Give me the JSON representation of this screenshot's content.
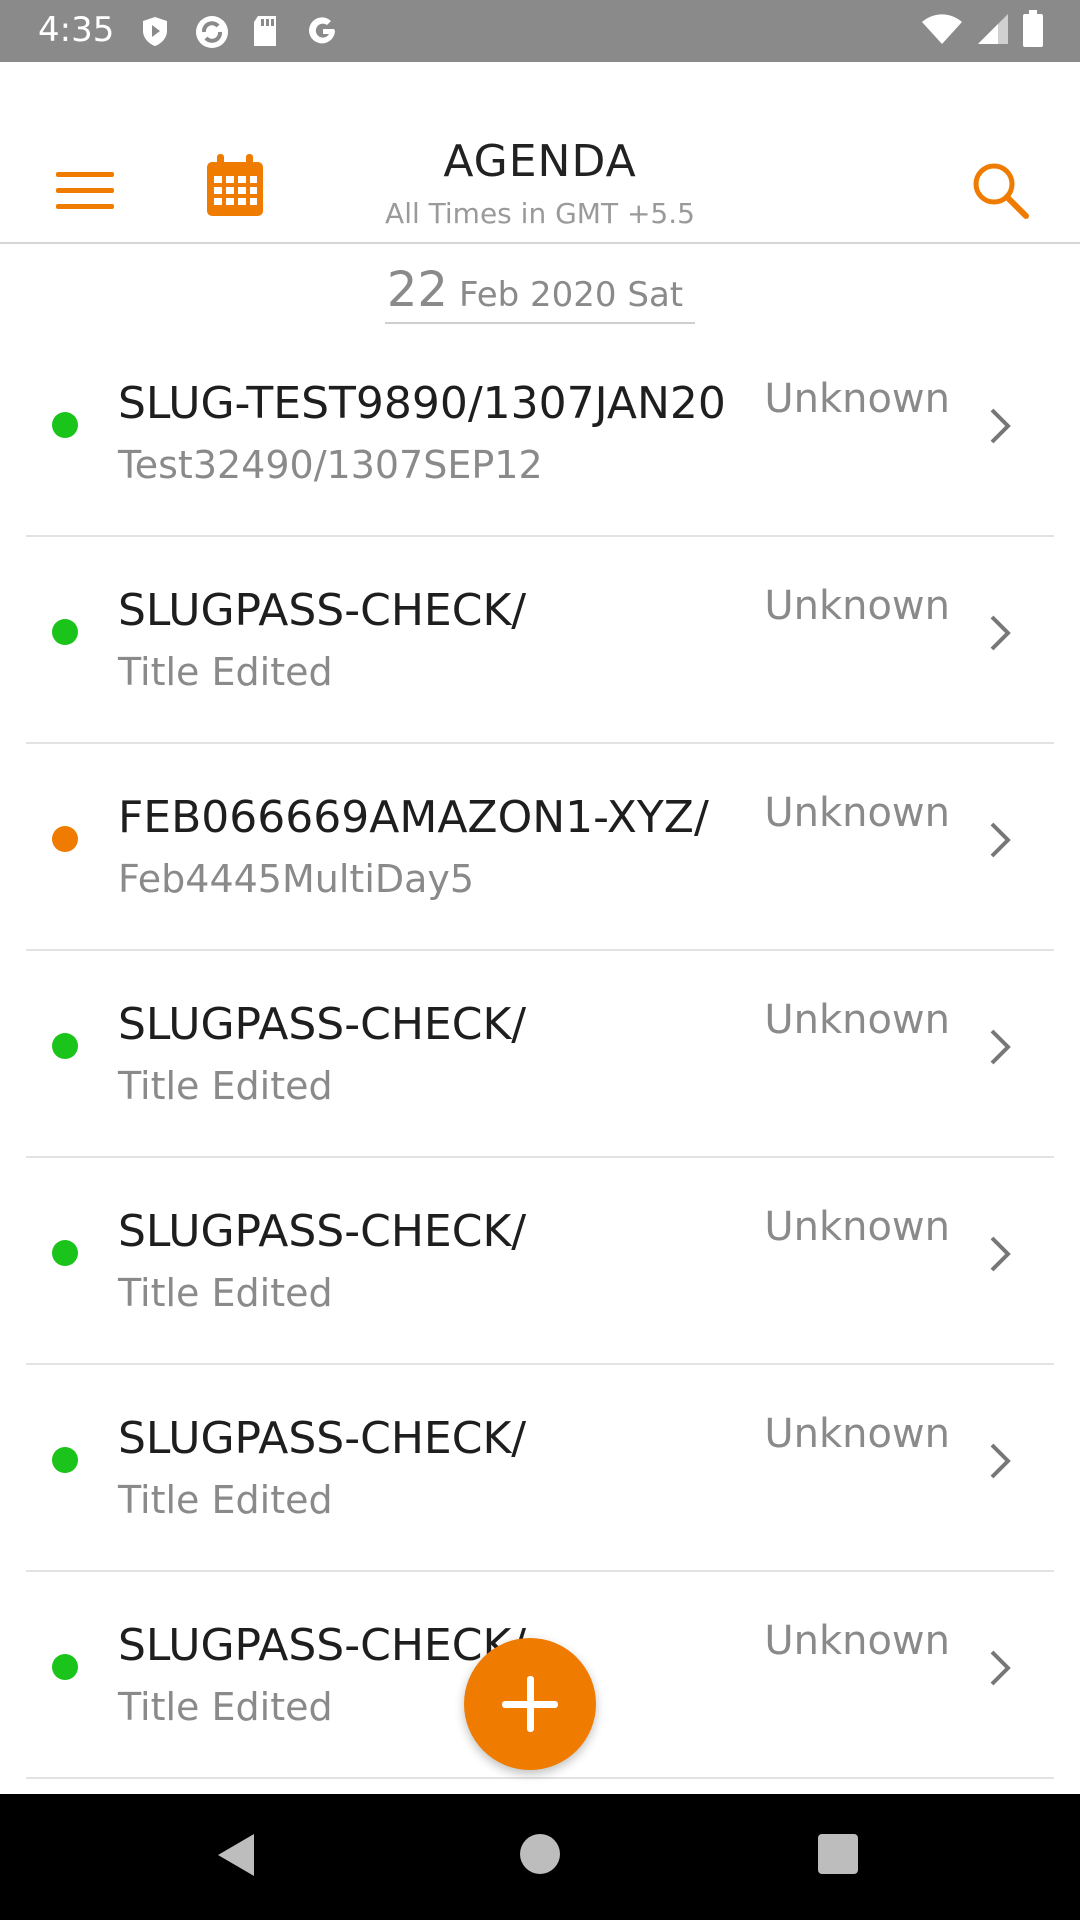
{
  "status_bar": {
    "time": "4:35",
    "icons_left": [
      "shield-play-icon",
      "sync-icon",
      "sd-card-icon",
      "google-icon"
    ],
    "icons_right": [
      "wifi-icon",
      "signal-icon",
      "battery-icon"
    ]
  },
  "app_bar": {
    "title": "AGENDA",
    "subtitle": "All Times in GMT +5.5",
    "accent_color": "#ef7c00"
  },
  "date_header": {
    "day": "22",
    "rest": "Feb 2020 Sat"
  },
  "items": [
    {
      "slug": "SLUG-TEST9890/1307JAN20",
      "title": "Test32490/1307SEP12",
      "status": "Unknown",
      "dot_color": "#1bc41b"
    },
    {
      "slug": "SLUGPASS-CHECK/",
      "title": "Title Edited",
      "status": "Unknown",
      "dot_color": "#1bc41b"
    },
    {
      "slug": "FEB066669AMAZON1-XYZ/",
      "title": "Feb4445MultiDay5",
      "status": "Unknown",
      "dot_color": "#ef7c00"
    },
    {
      "slug": "SLUGPASS-CHECK/",
      "title": "Title Edited",
      "status": "Unknown",
      "dot_color": "#1bc41b"
    },
    {
      "slug": "SLUGPASS-CHECK/",
      "title": "Title Edited",
      "status": "Unknown",
      "dot_color": "#1bc41b"
    },
    {
      "slug": "SLUGPASS-CHECK/",
      "title": "Title Edited",
      "status": "Unknown",
      "dot_color": "#1bc41b"
    },
    {
      "slug": "SLUGPASS-CHECK/",
      "title": "Title Edited",
      "status": "Unknown",
      "dot_color": "#1bc41b"
    }
  ],
  "fab": {
    "icon": "plus-icon"
  },
  "nav_bar": {
    "icons": [
      "back-icon",
      "home-icon",
      "recents-icon"
    ]
  }
}
